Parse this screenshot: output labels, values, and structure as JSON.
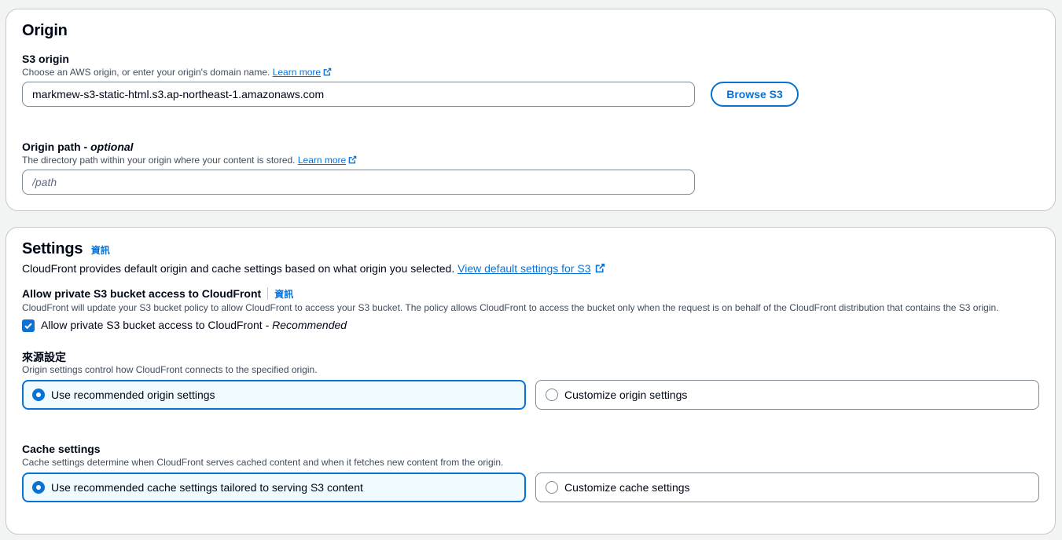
{
  "origin": {
    "title": "Origin",
    "s3_origin": {
      "label": "S3 origin",
      "description": "Choose an AWS origin, or enter your origin's domain name.",
      "learn_more": "Learn more",
      "value": "markmew-s3-static-html.s3.ap-northeast-1.amazonaws.com",
      "browse_button": "Browse S3"
    },
    "origin_path": {
      "label": "Origin path - ",
      "label_optional": "optional",
      "description": "The directory path within your origin where your content is stored.",
      "learn_more": "Learn more",
      "placeholder": "/path"
    }
  },
  "settings": {
    "title": "Settings",
    "info": "資訊",
    "description": "CloudFront provides default origin and cache settings based on what origin you selected.",
    "view_default_link": "View default settings for S3",
    "private_access": {
      "label": "Allow private S3 bucket access to CloudFront",
      "info": "資訊",
      "description": "CloudFront will update your S3 bucket policy to allow CloudFront to access your S3 bucket. The policy allows CloudFront to access the bucket only when the request is on behalf of the CloudFront distribution that contains the S3 origin.",
      "checkbox_label": "Allow private S3 bucket access to CloudFront - ",
      "checkbox_recommended": "Recommended",
      "checked": true
    },
    "origin_settings": {
      "label": "來源設定",
      "description": "Origin settings control how CloudFront connects to the specified origin.",
      "option_recommended": "Use recommended origin settings",
      "option_custom": "Customize origin settings",
      "selected": "recommended"
    },
    "cache_settings": {
      "label": "Cache settings",
      "description": "Cache settings determine when CloudFront serves cached content and when it fetches new content from the origin.",
      "option_recommended": "Use recommended cache settings tailored to serving S3 content",
      "option_custom": "Customize cache settings",
      "selected": "recommended"
    }
  },
  "colors": {
    "accent": "#0972d3",
    "selected_tile_bg": "#f0fbff",
    "border": "#7d8998",
    "text": "#000716",
    "secondary_text": "#414d5c"
  }
}
